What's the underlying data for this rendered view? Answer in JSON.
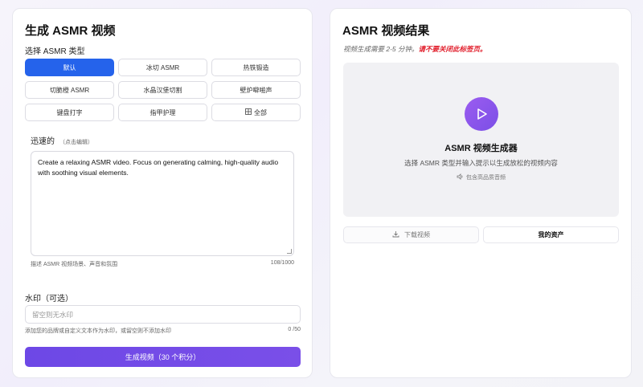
{
  "left": {
    "title": "生成 ASMR 视频",
    "type_label": "选择 ASMR 类型",
    "types": [
      {
        "label": "默认",
        "active": true
      },
      {
        "label": "冰切 ASMR",
        "active": false
      },
      {
        "label": "热铁锻造",
        "active": false
      },
      {
        "label": "切脆橙 ASMR",
        "active": false
      },
      {
        "label": "水晶汉堡切割",
        "active": false
      },
      {
        "label": "壁炉噼啪声",
        "active": false
      },
      {
        "label": "键盘打字",
        "active": false
      },
      {
        "label": "指甲护理",
        "active": false
      },
      {
        "label": "全部",
        "active": false,
        "icon": "grid-icon"
      }
    ],
    "prompt_label": "迅速的",
    "prompt_hint": "（点击编辑）",
    "prompt_text": "Create a relaxing ASMR video. Focus on generating calming, high-quality audio with soothing visual elements.",
    "prompt_desc": "描述 ASMR 视频场景、声音和氛围",
    "prompt_count": "108/1000",
    "watermark_label": "水印（可选）",
    "watermark_placeholder": "留空则无水印",
    "watermark_desc": "添加您的品牌或自定义文本作为水印，或留空则不添加水印",
    "watermark_count": "0 /50",
    "generate_label": "生成视频（30 个积分）",
    "colors": {
      "active": "#2563eb",
      "generate": "#6d48e6"
    }
  },
  "right": {
    "title": "ASMR 视频结果",
    "note": "视频生成需要 2-5 分钟。",
    "note_warn": "请不要关闭此标签页。",
    "preview_title": "ASMR 视频生成器",
    "preview_sub": "选择 ASMR 类型并输入提示以生成放松的视频内容",
    "preview_audio": "包含高品质音频",
    "download_label": "下载视频",
    "assets_label": "我的资产",
    "colors": {
      "play": "#8b55ec",
      "warn": "#e11d2a"
    }
  }
}
